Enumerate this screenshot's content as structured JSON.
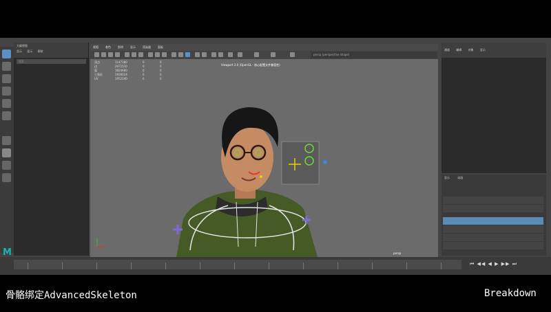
{
  "caption": {
    "title": "骨骼绑定AdvancedSkeleton",
    "tag": "Breakdown"
  },
  "outliner": {
    "title": "大纲视图",
    "menu": [
      "显示",
      "显示",
      "帮助"
    ],
    "search_placeholder": "搜索..."
  },
  "viewport": {
    "menu": [
      "视图",
      "着色",
      "照明",
      "显示",
      "渲染器",
      "面板"
    ],
    "camera_field": "persp (perspective shape)",
    "hud_rows": [
      [
        "顶点",
        "1147380",
        "0",
        "0"
      ],
      [
        "边",
        "2971510",
        "0",
        "0"
      ],
      [
        "面",
        "1824480",
        "0",
        "0"
      ],
      [
        "三角形",
        "1926024",
        "0",
        "0"
      ],
      [
        "UV",
        "1952240",
        "0",
        "0"
      ]
    ],
    "renderer_title": "Viewport 2.0 (OpenGL - 核心配置文件兼容性)",
    "camera_label": "persp"
  },
  "channel_box": {
    "tabs": [
      "通道",
      "编辑",
      "对象",
      "显示"
    ]
  },
  "layer_editor": {
    "tabs": [
      "显示",
      "动画"
    ]
  },
  "playback": {
    "controls": "⏮ ◀◀ ◀ ▶ ▶▶ ⏭"
  },
  "brand": {
    "logo": "M",
    "accent": "#1ab3b3"
  }
}
